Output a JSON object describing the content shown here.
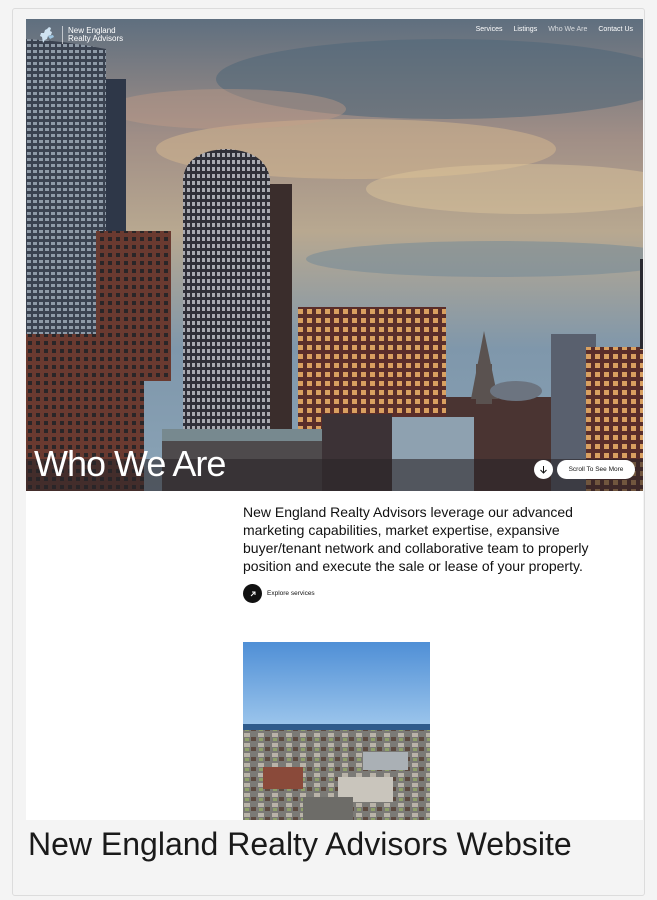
{
  "header": {
    "logo_line1": "New England",
    "logo_line2": "Realty Advisors",
    "nav": [
      {
        "label": "Services"
      },
      {
        "label": "Listings"
      },
      {
        "label": "Who We Are"
      },
      {
        "label": "Contact Us"
      }
    ]
  },
  "hero": {
    "title": "Who We Are",
    "scroll_label": "Scroll To See More",
    "scroll_icon": "arrow-down-icon"
  },
  "intro": {
    "text": "New England Realty Advisors leverage our advanced marketing capabilities, market expertise, expansive buyer/tenant network and collaborative team to properly position and execute the sale or lease of your property.",
    "link_label": "Explore services",
    "link_icon": "arrow-up-right-icon"
  },
  "caption": "New England Realty Advisors Website",
  "colors": {
    "accent_dark": "#111111",
    "page_background": "#ffffff",
    "frame_background": "#f4f4f4"
  }
}
